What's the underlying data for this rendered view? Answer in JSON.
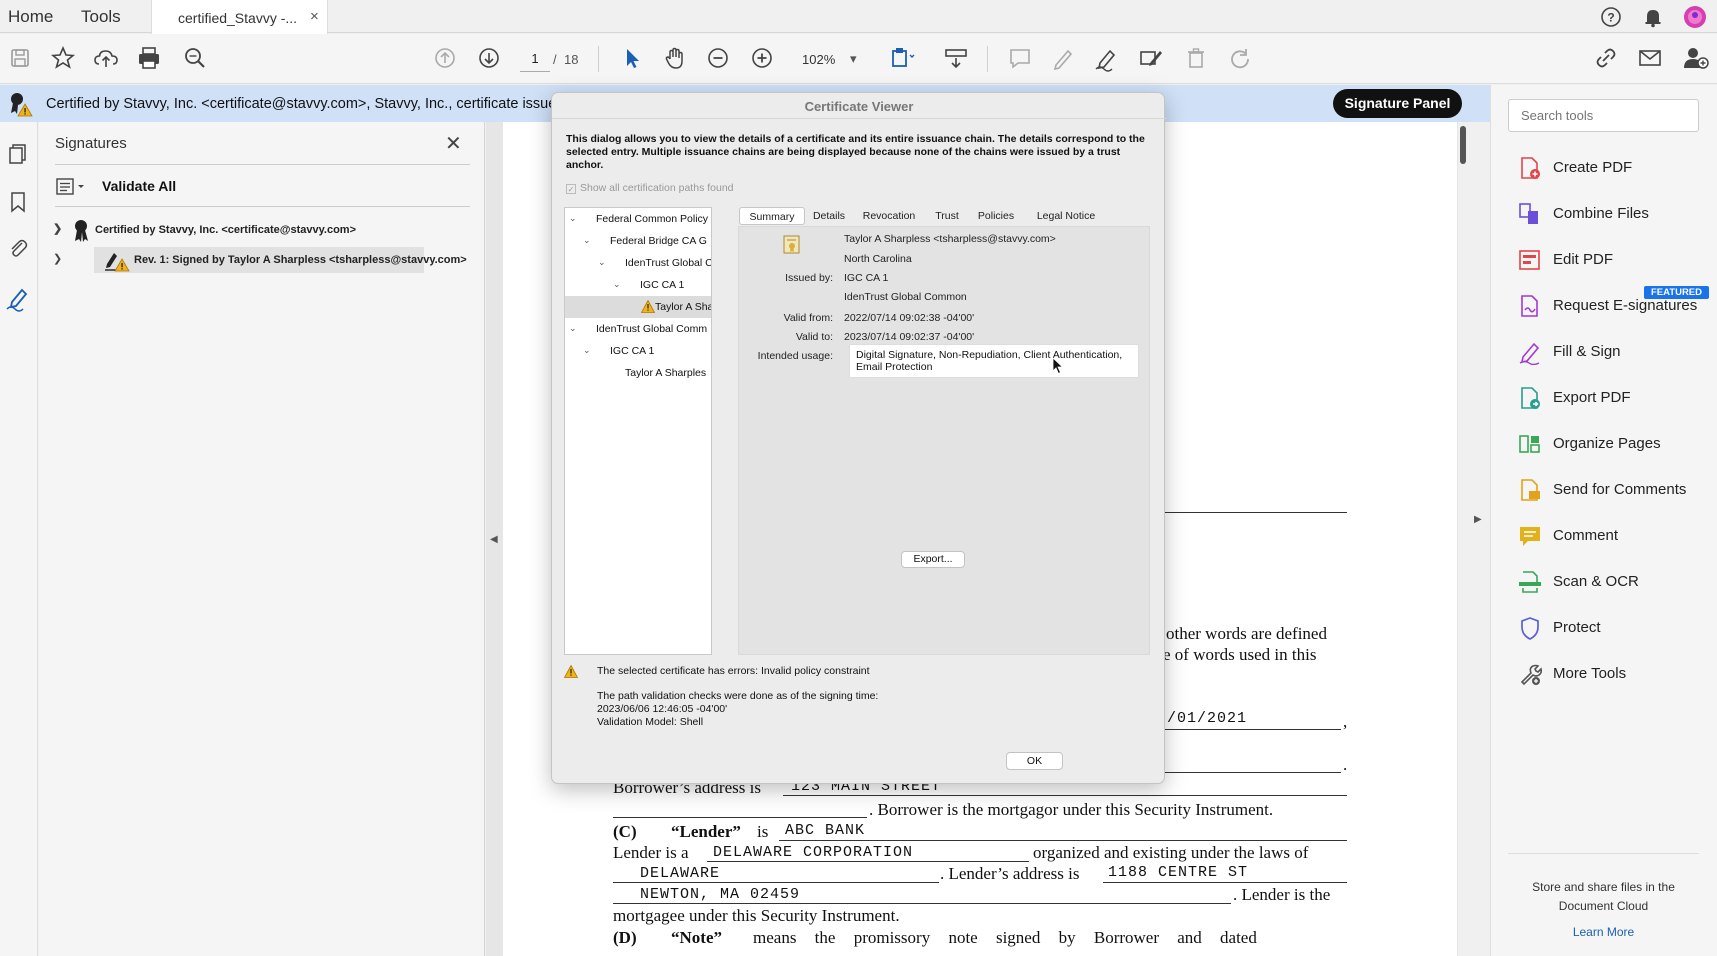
{
  "nav": {
    "home": "Home",
    "tools": "Tools"
  },
  "doc_tab": {
    "title": "certified_Stavvy -...",
    "close": "×"
  },
  "toolbar": {
    "page_current": "1",
    "page_sep": "/",
    "page_total": "18",
    "zoom": "102%",
    "zoom_arrow": "▾"
  },
  "banner": {
    "text": "Certified by Stavvy, Inc. <certificate@stavvy.com>, Stavvy, Inc., certificate issued",
    "button": "Signature Panel"
  },
  "signatures_panel": {
    "title": "Signatures",
    "close": "✕",
    "validate_all": "Validate All",
    "rows": [
      "Certified by Stavvy, Inc. <certificate@stavvy.com>",
      "Rev. 1: Signed by Taylor A Sharpless <tsharpless@stavvy.com>"
    ]
  },
  "document": {
    "line_other_words_1": "other words are defined",
    "line_other_words_2": "e of words used in this",
    "date_fragment": "/01/2021",
    "comma": ",",
    "period1": ".",
    "borrower_address_label": "Borrower’s address is",
    "borrower_address": "123 MAIN STREET",
    "borrower_mortgagor": ". Borrower is the mortgagor under this Security Instrument.",
    "c_label": "(C)",
    "lender_def": "“Lender”",
    "is": "is",
    "lender_name": "ABC BANK",
    "lender_is_a": "Lender is a",
    "lender_type": "DELAWARE CORPORATION",
    "organized": "organized and existing under the laws of",
    "state": "DELAWARE",
    "lender_address_label": ". Lender’s address is",
    "lender_address": "1188 CENTRE ST",
    "lender_city": "NEWTON, MA 02459",
    "lender_is_the": ". Lender is the",
    "mortgagee": "mortgagee under this Security Instrument.",
    "d_label": "(D)",
    "note_def": "“Note”",
    "note_rest": "means the promissory note signed by Borrower and dated"
  },
  "tools_panel": {
    "search_placeholder": "Search tools",
    "items": [
      {
        "label": "Create PDF",
        "color": "#e0464b"
      },
      {
        "label": "Combine Files",
        "color": "#6b4fd8"
      },
      {
        "label": "Edit PDF",
        "color": "#e0464b"
      },
      {
        "label": "Request E-signatures",
        "color": "#a23ad2"
      },
      {
        "label": "Fill & Sign",
        "color": "#a23ad2"
      },
      {
        "label": "Export PDF",
        "color": "#2a9d8f"
      },
      {
        "label": "Organize Pages",
        "color": "#3aa657"
      },
      {
        "label": "Send for Comments",
        "color": "#e3a21a"
      },
      {
        "label": "Comment",
        "color": "#e3b21a"
      },
      {
        "label": "Scan & OCR",
        "color": "#3aa657"
      },
      {
        "label": "Protect",
        "color": "#5a5fd8"
      },
      {
        "label": "More Tools",
        "color": "#555555"
      }
    ],
    "featured": "FEATURED",
    "cloud_text": "Store and share files in the Document Cloud",
    "learn_more": "Learn More"
  },
  "cert_viewer": {
    "title": "Certificate Viewer",
    "description": "This dialog allows you to view the details of a certificate and its entire issuance chain. The details correspond to the selected entry. Multiple issuance chains are being displayed because none of the chains were issued by a trust anchor.",
    "show_all": "Show all certification paths found",
    "tree": [
      "Federal Common Policy",
      "Federal Bridge CA G",
      "IdenTrust Global C",
      "IGC CA 1",
      "Taylor A Sha",
      "IdenTrust Global Comm",
      "IGC CA 1",
      "Taylor A Sharples"
    ],
    "tabs": [
      "Summary",
      "Details",
      "Revocation",
      "Trust",
      "Policies",
      "Legal Notice"
    ],
    "summary": {
      "subject": "Taylor A Sharpless <tsharpless@stavvy.com>",
      "region": "North Carolina",
      "issued_by_label": "Issued by:",
      "issued_by_1": "IGC CA 1",
      "issued_by_2": "IdenTrust Global Common",
      "valid_from_label": "Valid from:",
      "valid_from": "2022/07/14 09:02:38 -04'00'",
      "valid_to_label": "Valid to:",
      "valid_to": "2023/07/14 09:02:37 -04'00'",
      "usage_label": "Intended usage:",
      "usage": "Digital Signature, Non-Repudiation, Client Authentication, Email Protection"
    },
    "export_button": "Export...",
    "warning": "The selected certificate has errors: Invalid policy constraint",
    "path_check": "The path validation checks were done as of the signing time:",
    "signing_time": "2023/06/06 12:46:05 -04'00'",
    "validation_model": "Validation Model: Shell",
    "ok_button": "OK"
  }
}
